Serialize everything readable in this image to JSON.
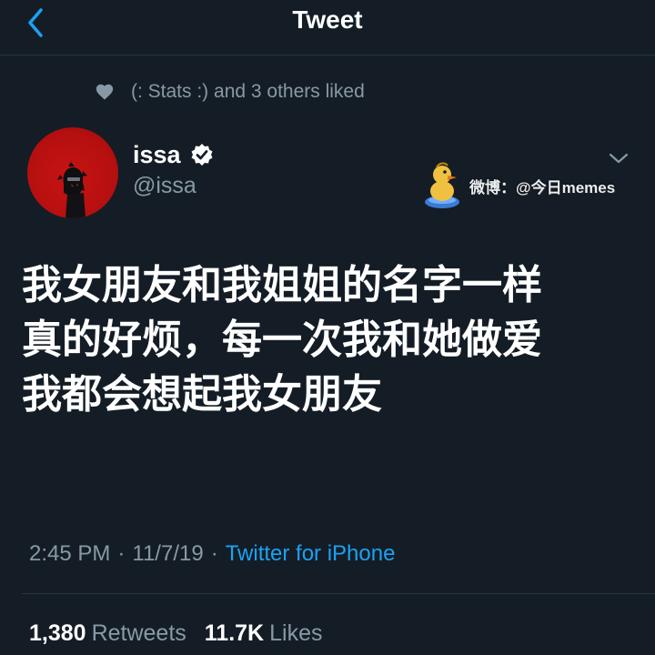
{
  "header": {
    "title": "Tweet",
    "back_icon": "chevron-left-icon"
  },
  "social_context": {
    "icon": "heart-icon",
    "text": "(: Stats :) and 3 others liked"
  },
  "author": {
    "display_name": "issa",
    "verified": true,
    "handle": "@issa"
  },
  "watermark": {
    "text": "微博：@今日memes"
  },
  "tweet": {
    "text": "我女朋友和我姐姐的名字一样\n真的好烦，每一次我和她做爱\n我都会想起我女朋友"
  },
  "meta": {
    "time": "2:45 PM",
    "separator": "·",
    "date": "11/7/19",
    "client": "Twitter for iPhone"
  },
  "stats": {
    "retweets_count": "1,380",
    "retweets_label": "Retweets",
    "likes_count": "11.7K",
    "likes_label": "Likes"
  },
  "colors": {
    "background": "#141d26",
    "accent": "#1da1f2",
    "secondary_text": "#8899a6",
    "avatar_red": "#c71414"
  }
}
